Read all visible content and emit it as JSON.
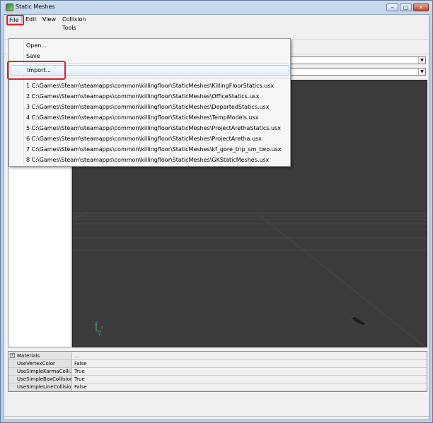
{
  "window": {
    "title": "Static Meshes",
    "min": "–",
    "max": "▢",
    "close": "✕"
  },
  "menubar": {
    "file": "File",
    "edit": "Edit",
    "view": "View",
    "collision": "Collision Tools"
  },
  "file_menu": {
    "open": "Open...",
    "save": "Save",
    "import": "Import...",
    "recent": [
      "1 C:\\Games\\Steam\\steamapps\\common\\killingfloor\\StaticMeshes\\KillingFloorStatics.usx",
      "2 C:\\Games\\Steam\\steamapps\\common\\killingfloor\\StaticMeshes\\OfficeStatics.usx",
      "3 C:\\Games\\Steam\\steamapps\\common\\killingfloor\\StaticMeshes\\DepartedStatics.usx",
      "4 C:\\Games\\Steam\\steamapps\\common\\killingfloor\\StaticMeshes\\TempModels.usx",
      "5 C:\\Games\\Steam\\steamapps\\common\\killingfloor\\StaticMeshes\\ProjectArethaStatics.usx",
      "6 C:\\Games\\Steam\\steamapps\\common\\killingfloor\\StaticMeshes\\ProjectAretha.usx",
      "7 C:\\Games\\Steam\\steamapps\\common\\killingfloor\\StaticMeshes\\kf_gore_trip_sm_two.usx",
      "8 C:\\Games\\Steam\\steamapps\\common\\killingfloor\\StaticMeshes\\GKStaticMeshes.usx"
    ]
  },
  "combos": {
    "arrow": "▼"
  },
  "properties": [
    {
      "name": "Materials",
      "value": "...",
      "expand": "+"
    },
    {
      "name": "UseVertexColor",
      "value": "False"
    },
    {
      "name": "UseSimpleKarmaColli...",
      "value": "True"
    },
    {
      "name": "UseSimpleBoxCollision",
      "value": "True"
    },
    {
      "name": "UseSimpleLineCollision",
      "value": "False"
    }
  ],
  "viewport": {
    "axis_z": "Z",
    "axis_x": "X",
    "axis_y": "Y"
  },
  "icons": {
    "app": "static-mesh-app-icon"
  },
  "colors": {
    "highlight": "#e22222",
    "viewport_bg": "#3b3b3b"
  }
}
